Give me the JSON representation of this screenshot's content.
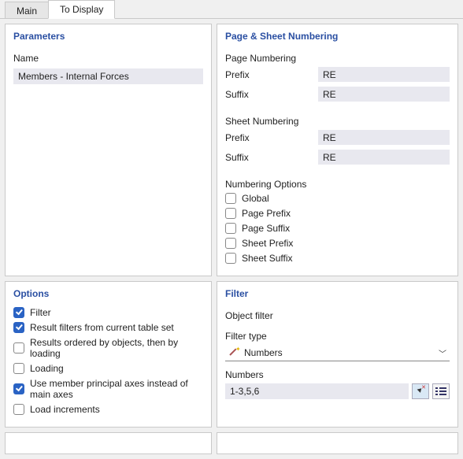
{
  "tabs": {
    "main": "Main",
    "to_display": "To Display"
  },
  "parameters": {
    "title": "Parameters",
    "name_label": "Name",
    "name_value": "Members - Internal Forces"
  },
  "numbering": {
    "title": "Page & Sheet Numbering",
    "page_heading": "Page Numbering",
    "sheet_heading": "Sheet Numbering",
    "prefix_label": "Prefix",
    "suffix_label": "Suffix",
    "page_prefix": "RE",
    "page_suffix": "RE",
    "sheet_prefix": "RE",
    "sheet_suffix": "RE",
    "options_heading": "Numbering Options",
    "opts": {
      "global": "Global",
      "page_prefix": "Page Prefix",
      "page_suffix": "Page Suffix",
      "sheet_prefix": "Sheet Prefix",
      "sheet_suffix": "Sheet Suffix"
    }
  },
  "options": {
    "title": "Options",
    "items": {
      "filter": {
        "label": "Filter",
        "checked": true
      },
      "result_filters": {
        "label": "Result filters from current table set",
        "checked": true
      },
      "ordered": {
        "label": "Results ordered by objects, then by loading",
        "checked": false
      },
      "loading": {
        "label": "Loading",
        "checked": false
      },
      "principal_axes": {
        "label": "Use member principal axes instead of main axes",
        "checked": true
      },
      "load_increments": {
        "label": "Load increments",
        "checked": false
      }
    }
  },
  "filter": {
    "title": "Filter",
    "object_filter_label": "Object filter",
    "filter_type_label": "Filter type",
    "filter_type_value": "Numbers",
    "numbers_label": "Numbers",
    "numbers_value": "1-3,5,6"
  }
}
